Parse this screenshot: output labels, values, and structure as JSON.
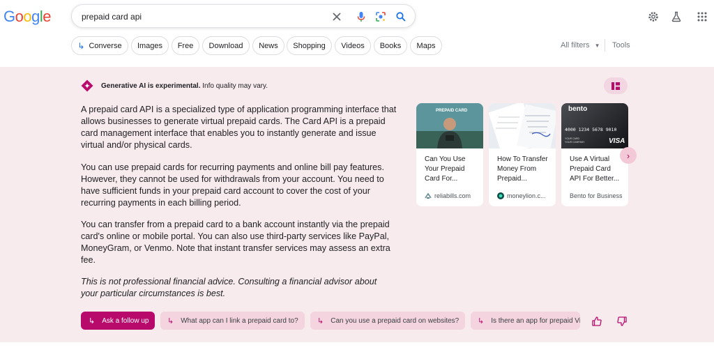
{
  "logo": {
    "letters": [
      "G",
      "o",
      "o",
      "g",
      "l",
      "e"
    ],
    "colors": [
      "#4285F4",
      "#EA4335",
      "#FBBC05",
      "#4285F4",
      "#34A853",
      "#EA4335"
    ]
  },
  "search": {
    "query": "prepaid card api"
  },
  "icons": {
    "clear": "close-icon",
    "voice": "mic-icon",
    "lens": "lens-icon",
    "search": "search-icon",
    "settings": "gear-icon",
    "labs": "flask-icon",
    "apps": "apps-grid-icon"
  },
  "chips": [
    "Converse",
    "Images",
    "Free",
    "Download",
    "News",
    "Shopping",
    "Videos",
    "Books",
    "Maps"
  ],
  "filters": {
    "all_filters": "All filters",
    "tools": "Tools"
  },
  "ai": {
    "header_bold": "Generative AI is experimental.",
    "header_rest": " Info quality may vary.",
    "paragraphs": [
      "A prepaid card API is a specialized type of application programming interface that allows businesses to generate virtual prepaid cards. The Card API is a prepaid card management interface that enables you to instantly generate and issue virtual and/or physical cards.",
      "You can use prepaid cards for recurring payments and online bill pay features. However, they cannot be used for withdrawals from your account. You need to have sufficient funds in your prepaid card account to cover the cost of your recurring payments in each billing period.",
      "You can transfer from a prepaid card to a bank account instantly via the prepaid card's online or mobile portal. You can also use third-party services like PayPal, MoneyGram, or Venmo. Note that instant transfer services may assess an extra fee."
    ],
    "disclaimer": "This is not professional financial advice. Consulting a financial advisor about your particular circumstances is best.",
    "cards": [
      {
        "title": "Can You Use Your Prepaid Card For...",
        "source": "reliabills.com",
        "thumb_text": "PREPAID CARD"
      },
      {
        "title": "How To Transfer Money From Prepaid...",
        "source": "moneylion.c...",
        "thumb_text": ""
      },
      {
        "title": "Use A Virtual Prepaid Card API For Better...",
        "source": "Bento for Business",
        "thumb_text": "bento",
        "card_number": "4000  1234  5678  9010",
        "card_brand": "VISA",
        "card_small_1": "YOUR CARD",
        "card_small_2": "YOUR COMPANY"
      }
    ],
    "followups": [
      "Ask a follow up",
      "What app can I link a prepaid card to?",
      "Can you use a prepaid card on websites?",
      "Is there an app for prepaid Vi"
    ],
    "accent": "#b80a6b",
    "panel_bg": "#f8ebee"
  }
}
